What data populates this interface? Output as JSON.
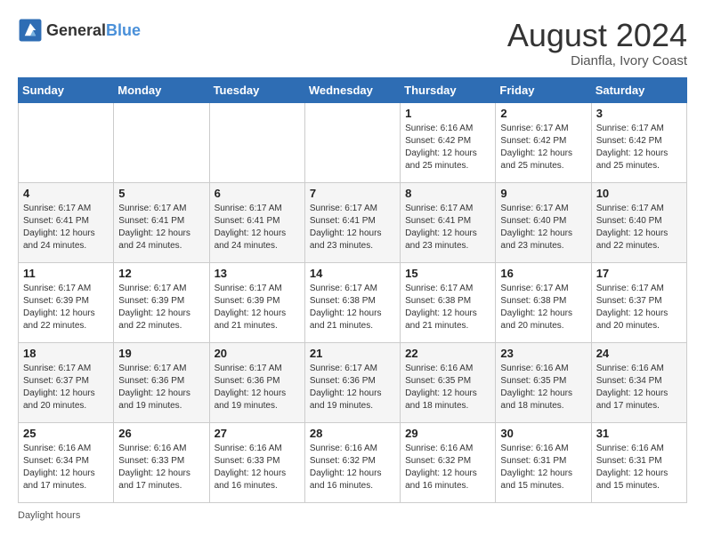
{
  "header": {
    "logo_general": "General",
    "logo_blue": "Blue",
    "month_year": "August 2024",
    "location": "Dianfla, Ivory Coast"
  },
  "days_of_week": [
    "Sunday",
    "Monday",
    "Tuesday",
    "Wednesday",
    "Thursday",
    "Friday",
    "Saturday"
  ],
  "weeks": [
    [
      {
        "day": "",
        "info": ""
      },
      {
        "day": "",
        "info": ""
      },
      {
        "day": "",
        "info": ""
      },
      {
        "day": "",
        "info": ""
      },
      {
        "day": "1",
        "info": "Sunrise: 6:16 AM\nSunset: 6:42 PM\nDaylight: 12 hours\nand 25 minutes."
      },
      {
        "day": "2",
        "info": "Sunrise: 6:17 AM\nSunset: 6:42 PM\nDaylight: 12 hours\nand 25 minutes."
      },
      {
        "day": "3",
        "info": "Sunrise: 6:17 AM\nSunset: 6:42 PM\nDaylight: 12 hours\nand 25 minutes."
      }
    ],
    [
      {
        "day": "4",
        "info": "Sunrise: 6:17 AM\nSunset: 6:41 PM\nDaylight: 12 hours\nand 24 minutes."
      },
      {
        "day": "5",
        "info": "Sunrise: 6:17 AM\nSunset: 6:41 PM\nDaylight: 12 hours\nand 24 minutes."
      },
      {
        "day": "6",
        "info": "Sunrise: 6:17 AM\nSunset: 6:41 PM\nDaylight: 12 hours\nand 24 minutes."
      },
      {
        "day": "7",
        "info": "Sunrise: 6:17 AM\nSunset: 6:41 PM\nDaylight: 12 hours\nand 23 minutes."
      },
      {
        "day": "8",
        "info": "Sunrise: 6:17 AM\nSunset: 6:41 PM\nDaylight: 12 hours\nand 23 minutes."
      },
      {
        "day": "9",
        "info": "Sunrise: 6:17 AM\nSunset: 6:40 PM\nDaylight: 12 hours\nand 23 minutes."
      },
      {
        "day": "10",
        "info": "Sunrise: 6:17 AM\nSunset: 6:40 PM\nDaylight: 12 hours\nand 22 minutes."
      }
    ],
    [
      {
        "day": "11",
        "info": "Sunrise: 6:17 AM\nSunset: 6:39 PM\nDaylight: 12 hours\nand 22 minutes."
      },
      {
        "day": "12",
        "info": "Sunrise: 6:17 AM\nSunset: 6:39 PM\nDaylight: 12 hours\nand 22 minutes."
      },
      {
        "day": "13",
        "info": "Sunrise: 6:17 AM\nSunset: 6:39 PM\nDaylight: 12 hours\nand 21 minutes."
      },
      {
        "day": "14",
        "info": "Sunrise: 6:17 AM\nSunset: 6:38 PM\nDaylight: 12 hours\nand 21 minutes."
      },
      {
        "day": "15",
        "info": "Sunrise: 6:17 AM\nSunset: 6:38 PM\nDaylight: 12 hours\nand 21 minutes."
      },
      {
        "day": "16",
        "info": "Sunrise: 6:17 AM\nSunset: 6:38 PM\nDaylight: 12 hours\nand 20 minutes."
      },
      {
        "day": "17",
        "info": "Sunrise: 6:17 AM\nSunset: 6:37 PM\nDaylight: 12 hours\nand 20 minutes."
      }
    ],
    [
      {
        "day": "18",
        "info": "Sunrise: 6:17 AM\nSunset: 6:37 PM\nDaylight: 12 hours\nand 20 minutes."
      },
      {
        "day": "19",
        "info": "Sunrise: 6:17 AM\nSunset: 6:36 PM\nDaylight: 12 hours\nand 19 minutes."
      },
      {
        "day": "20",
        "info": "Sunrise: 6:17 AM\nSunset: 6:36 PM\nDaylight: 12 hours\nand 19 minutes."
      },
      {
        "day": "21",
        "info": "Sunrise: 6:17 AM\nSunset: 6:36 PM\nDaylight: 12 hours\nand 19 minutes."
      },
      {
        "day": "22",
        "info": "Sunrise: 6:16 AM\nSunset: 6:35 PM\nDaylight: 12 hours\nand 18 minutes."
      },
      {
        "day": "23",
        "info": "Sunrise: 6:16 AM\nSunset: 6:35 PM\nDaylight: 12 hours\nand 18 minutes."
      },
      {
        "day": "24",
        "info": "Sunrise: 6:16 AM\nSunset: 6:34 PM\nDaylight: 12 hours\nand 17 minutes."
      }
    ],
    [
      {
        "day": "25",
        "info": "Sunrise: 6:16 AM\nSunset: 6:34 PM\nDaylight: 12 hours\nand 17 minutes."
      },
      {
        "day": "26",
        "info": "Sunrise: 6:16 AM\nSunset: 6:33 PM\nDaylight: 12 hours\nand 17 minutes."
      },
      {
        "day": "27",
        "info": "Sunrise: 6:16 AM\nSunset: 6:33 PM\nDaylight: 12 hours\nand 16 minutes."
      },
      {
        "day": "28",
        "info": "Sunrise: 6:16 AM\nSunset: 6:32 PM\nDaylight: 12 hours\nand 16 minutes."
      },
      {
        "day": "29",
        "info": "Sunrise: 6:16 AM\nSunset: 6:32 PM\nDaylight: 12 hours\nand 16 minutes."
      },
      {
        "day": "30",
        "info": "Sunrise: 6:16 AM\nSunset: 6:31 PM\nDaylight: 12 hours\nand 15 minutes."
      },
      {
        "day": "31",
        "info": "Sunrise: 6:16 AM\nSunset: 6:31 PM\nDaylight: 12 hours\nand 15 minutes."
      }
    ]
  ],
  "footer": {
    "note": "Daylight hours"
  }
}
